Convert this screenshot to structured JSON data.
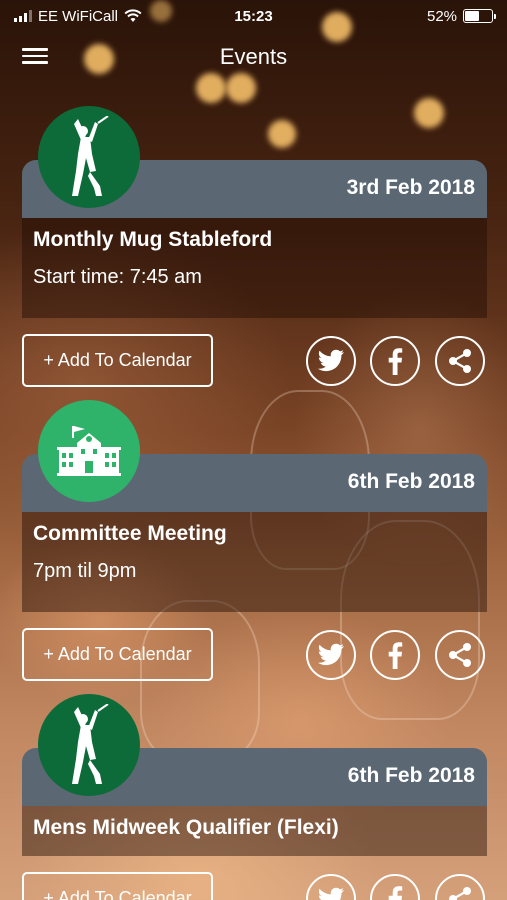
{
  "status_bar": {
    "carrier": "EE WiFiCall",
    "time": "15:23",
    "battery_text": "52%",
    "battery_level": 0.52
  },
  "header": {
    "title": "Events"
  },
  "events": [
    {
      "icon": "golfer-icon",
      "icon_bg": "#0d6b3a",
      "date": "3rd Feb 2018",
      "title": "Monthly Mug Stableford",
      "time": "Start time: 7:45 am",
      "add_label": "+ Add To Calendar"
    },
    {
      "icon": "clubhouse-icon",
      "icon_bg": "#2fb36a",
      "date": "6th Feb 2018",
      "title": "Committee Meeting",
      "time": "7pm til 9pm",
      "add_label": "+ Add To Calendar"
    },
    {
      "icon": "golfer-icon",
      "icon_bg": "#0d6b3a",
      "date": "6th Feb 2018",
      "title": "Mens Midweek Qualifier (Flexi)",
      "time": "",
      "add_label": "+ Add To Calendar"
    }
  ],
  "colors": {
    "card_header": "#5b6874",
    "golf_green": "#0d6b3a",
    "club_green": "#2fb36a"
  }
}
